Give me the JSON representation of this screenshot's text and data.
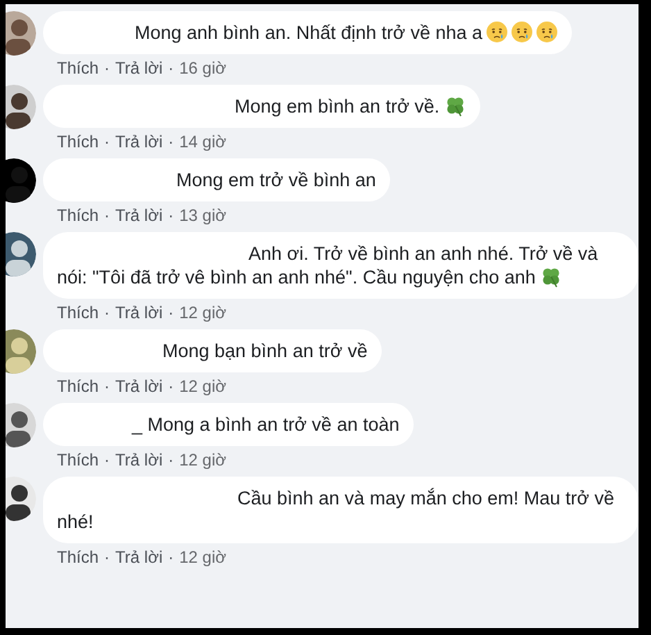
{
  "comments": [
    {
      "text": "Mong anh bình an. Nhất định trở về nha a",
      "emojis": [
        {
          "kind": "crying"
        },
        {
          "kind": "crying"
        },
        {
          "kind": "crying"
        }
      ],
      "like": "Thích",
      "reply": "Trả lời",
      "time": "16 giờ",
      "separators": [
        "·",
        "·"
      ]
    },
    {
      "text": "Mong em bình an trở về.",
      "emojis": [
        {
          "kind": "clover"
        }
      ],
      "like": "Thích",
      "reply": "Trả lời",
      "time": "14 giờ",
      "separators": [
        "·",
        "·"
      ]
    },
    {
      "text": "Mong em trở về bình an",
      "like": "Thích",
      "reply": "Trả lời",
      "time": "13 giờ",
      "separators": [
        "·",
        "·"
      ]
    },
    {
      "text": "Anh ơi. Trở về bình an anh nhé. Trở về và nói: \"Tôi đã trở vê bình an anh nhé\". Cầu nguyện cho anh",
      "emojis": [
        {
          "kind": "clover"
        }
      ],
      "like": "Thích",
      "reply": "Trả lời",
      "time": "12 giờ",
      "separators": [
        "·",
        "·"
      ]
    },
    {
      "text": "Mong bạn bình an trở về",
      "like": "Thích",
      "reply": "Trả lời",
      "time": "12 giờ",
      "separators": [
        "·",
        "·"
      ]
    },
    {
      "text": "_ Mong a bình an trở về an toàn",
      "like": "Thích",
      "reply": "Trả lời",
      "time": "12 giờ",
      "separators": [
        "·",
        "·"
      ]
    },
    {
      "text": "Cầu bình an và may mắn cho em! Mau trở về nhé!",
      "like": "Thích",
      "reply": "Trả lời",
      "time": "12 giờ",
      "separators": [
        "·",
        "·"
      ]
    }
  ]
}
